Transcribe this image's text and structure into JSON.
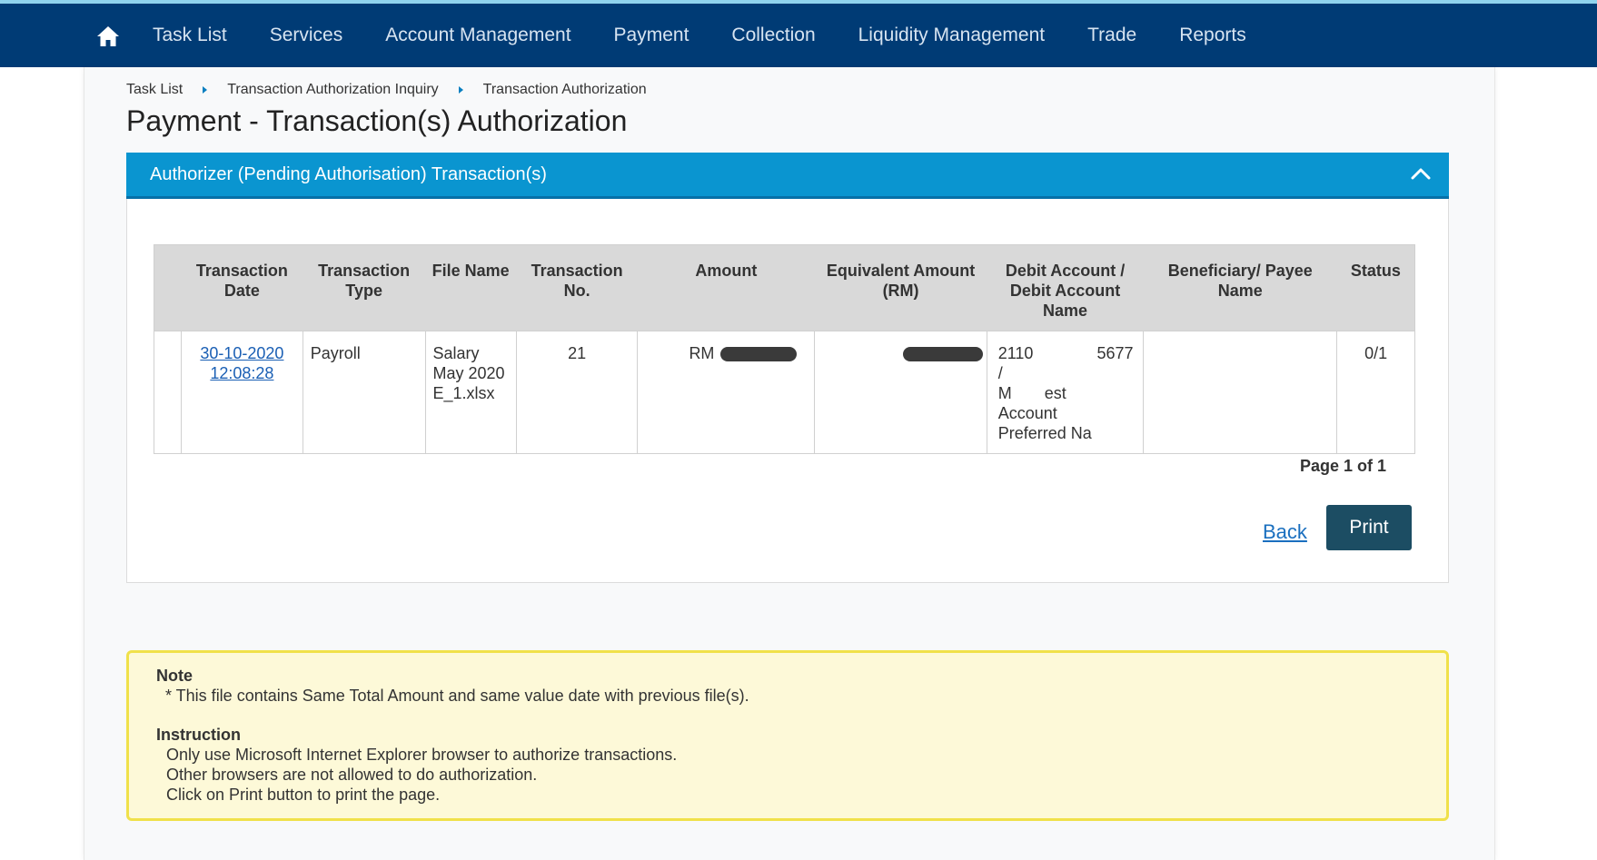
{
  "nav": {
    "items": [
      "Task List",
      "Services",
      "Account Management",
      "Payment",
      "Collection",
      "Liquidity Management",
      "Trade",
      "Reports"
    ]
  },
  "breadcrumb": [
    "Task List",
    "Transaction Authorization Inquiry",
    "Transaction Authorization"
  ],
  "page_title": "Payment - Transaction(s) Authorization",
  "panel": {
    "title": "Authorizer (Pending Authorisation) Transaction(s)"
  },
  "table": {
    "headers": {
      "date": "Transaction Date",
      "type": "Transaction Type",
      "file": "File Name",
      "no": "Transaction No.",
      "amount": "Amount",
      "equiv": "Equivalent Amount (RM)",
      "debit": "Debit Account / Debit Account Name",
      "beneficiary": "Beneficiary/ Payee Name",
      "status": "Status"
    },
    "row": {
      "date_line1": "30-10-2020",
      "date_line2": "12:08:28",
      "type": "Payroll",
      "file": "Salary May 2020 E_1.xlsx",
      "no": "21",
      "amount_prefix": "RM",
      "debit_acct_a": "2110",
      "debit_acct_b": "5677",
      "debit_sep": "/",
      "debit_name_a": "M",
      "debit_name_b": "est",
      "debit_name_c": "Account",
      "debit_name_d": "Preferred Na",
      "beneficiary": "",
      "status": "0/1"
    }
  },
  "pager": "Page 1 of 1",
  "buttons": {
    "back": "Back",
    "print": "Print"
  },
  "note": {
    "heading": "Note",
    "text": "* This file contains Same Total Amount and same value date with previous file(s).",
    "instruction_heading": "Instruction",
    "instructions": [
      "Only use Microsoft Internet Explorer browser to authorize transactions.",
      "Other browsers are not allowed to do authorization.",
      "Click on Print button to print the page."
    ]
  },
  "colors": {
    "navbar": "#003b75",
    "panel_header": "#0a95d0",
    "print_button": "#1c4d63",
    "note_bg": "#fdf9d8",
    "note_border": "#f0e14a"
  }
}
